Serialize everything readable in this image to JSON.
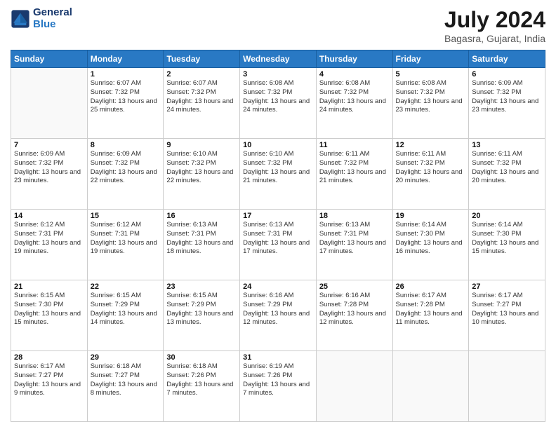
{
  "header": {
    "logo_line1": "General",
    "logo_line2": "Blue",
    "title": "July 2024",
    "subtitle": "Bagasra, Gujarat, India"
  },
  "days": [
    "Sunday",
    "Monday",
    "Tuesday",
    "Wednesday",
    "Thursday",
    "Friday",
    "Saturday"
  ],
  "weeks": [
    [
      {
        "day": "",
        "sunrise": "",
        "sunset": "",
        "daylight": ""
      },
      {
        "day": "1",
        "sunrise": "Sunrise: 6:07 AM",
        "sunset": "Sunset: 7:32 PM",
        "daylight": "Daylight: 13 hours and 25 minutes."
      },
      {
        "day": "2",
        "sunrise": "Sunrise: 6:07 AM",
        "sunset": "Sunset: 7:32 PM",
        "daylight": "Daylight: 13 hours and 24 minutes."
      },
      {
        "day": "3",
        "sunrise": "Sunrise: 6:08 AM",
        "sunset": "Sunset: 7:32 PM",
        "daylight": "Daylight: 13 hours and 24 minutes."
      },
      {
        "day": "4",
        "sunrise": "Sunrise: 6:08 AM",
        "sunset": "Sunset: 7:32 PM",
        "daylight": "Daylight: 13 hours and 24 minutes."
      },
      {
        "day": "5",
        "sunrise": "Sunrise: 6:08 AM",
        "sunset": "Sunset: 7:32 PM",
        "daylight": "Daylight: 13 hours and 23 minutes."
      },
      {
        "day": "6",
        "sunrise": "Sunrise: 6:09 AM",
        "sunset": "Sunset: 7:32 PM",
        "daylight": "Daylight: 13 hours and 23 minutes."
      }
    ],
    [
      {
        "day": "7",
        "sunrise": "Sunrise: 6:09 AM",
        "sunset": "Sunset: 7:32 PM",
        "daylight": "Daylight: 13 hours and 23 minutes."
      },
      {
        "day": "8",
        "sunrise": "Sunrise: 6:09 AM",
        "sunset": "Sunset: 7:32 PM",
        "daylight": "Daylight: 13 hours and 22 minutes."
      },
      {
        "day": "9",
        "sunrise": "Sunrise: 6:10 AM",
        "sunset": "Sunset: 7:32 PM",
        "daylight": "Daylight: 13 hours and 22 minutes."
      },
      {
        "day": "10",
        "sunrise": "Sunrise: 6:10 AM",
        "sunset": "Sunset: 7:32 PM",
        "daylight": "Daylight: 13 hours and 21 minutes."
      },
      {
        "day": "11",
        "sunrise": "Sunrise: 6:11 AM",
        "sunset": "Sunset: 7:32 PM",
        "daylight": "Daylight: 13 hours and 21 minutes."
      },
      {
        "day": "12",
        "sunrise": "Sunrise: 6:11 AM",
        "sunset": "Sunset: 7:32 PM",
        "daylight": "Daylight: 13 hours and 20 minutes."
      },
      {
        "day": "13",
        "sunrise": "Sunrise: 6:11 AM",
        "sunset": "Sunset: 7:32 PM",
        "daylight": "Daylight: 13 hours and 20 minutes."
      }
    ],
    [
      {
        "day": "14",
        "sunrise": "Sunrise: 6:12 AM",
        "sunset": "Sunset: 7:31 PM",
        "daylight": "Daylight: 13 hours and 19 minutes."
      },
      {
        "day": "15",
        "sunrise": "Sunrise: 6:12 AM",
        "sunset": "Sunset: 7:31 PM",
        "daylight": "Daylight: 13 hours and 19 minutes."
      },
      {
        "day": "16",
        "sunrise": "Sunrise: 6:13 AM",
        "sunset": "Sunset: 7:31 PM",
        "daylight": "Daylight: 13 hours and 18 minutes."
      },
      {
        "day": "17",
        "sunrise": "Sunrise: 6:13 AM",
        "sunset": "Sunset: 7:31 PM",
        "daylight": "Daylight: 13 hours and 17 minutes."
      },
      {
        "day": "18",
        "sunrise": "Sunrise: 6:13 AM",
        "sunset": "Sunset: 7:31 PM",
        "daylight": "Daylight: 13 hours and 17 minutes."
      },
      {
        "day": "19",
        "sunrise": "Sunrise: 6:14 AM",
        "sunset": "Sunset: 7:30 PM",
        "daylight": "Daylight: 13 hours and 16 minutes."
      },
      {
        "day": "20",
        "sunrise": "Sunrise: 6:14 AM",
        "sunset": "Sunset: 7:30 PM",
        "daylight": "Daylight: 13 hours and 15 minutes."
      }
    ],
    [
      {
        "day": "21",
        "sunrise": "Sunrise: 6:15 AM",
        "sunset": "Sunset: 7:30 PM",
        "daylight": "Daylight: 13 hours and 15 minutes."
      },
      {
        "day": "22",
        "sunrise": "Sunrise: 6:15 AM",
        "sunset": "Sunset: 7:29 PM",
        "daylight": "Daylight: 13 hours and 14 minutes."
      },
      {
        "day": "23",
        "sunrise": "Sunrise: 6:15 AM",
        "sunset": "Sunset: 7:29 PM",
        "daylight": "Daylight: 13 hours and 13 minutes."
      },
      {
        "day": "24",
        "sunrise": "Sunrise: 6:16 AM",
        "sunset": "Sunset: 7:29 PM",
        "daylight": "Daylight: 13 hours and 12 minutes."
      },
      {
        "day": "25",
        "sunrise": "Sunrise: 6:16 AM",
        "sunset": "Sunset: 7:28 PM",
        "daylight": "Daylight: 13 hours and 12 minutes."
      },
      {
        "day": "26",
        "sunrise": "Sunrise: 6:17 AM",
        "sunset": "Sunset: 7:28 PM",
        "daylight": "Daylight: 13 hours and 11 minutes."
      },
      {
        "day": "27",
        "sunrise": "Sunrise: 6:17 AM",
        "sunset": "Sunset: 7:27 PM",
        "daylight": "Daylight: 13 hours and 10 minutes."
      }
    ],
    [
      {
        "day": "28",
        "sunrise": "Sunrise: 6:17 AM",
        "sunset": "Sunset: 7:27 PM",
        "daylight": "Daylight: 13 hours and 9 minutes."
      },
      {
        "day": "29",
        "sunrise": "Sunrise: 6:18 AM",
        "sunset": "Sunset: 7:27 PM",
        "daylight": "Daylight: 13 hours and 8 minutes."
      },
      {
        "day": "30",
        "sunrise": "Sunrise: 6:18 AM",
        "sunset": "Sunset: 7:26 PM",
        "daylight": "Daylight: 13 hours and 7 minutes."
      },
      {
        "day": "31",
        "sunrise": "Sunrise: 6:19 AM",
        "sunset": "Sunset: 7:26 PM",
        "daylight": "Daylight: 13 hours and 7 minutes."
      },
      {
        "day": "",
        "sunrise": "",
        "sunset": "",
        "daylight": ""
      },
      {
        "day": "",
        "sunrise": "",
        "sunset": "",
        "daylight": ""
      },
      {
        "day": "",
        "sunrise": "",
        "sunset": "",
        "daylight": ""
      }
    ]
  ]
}
